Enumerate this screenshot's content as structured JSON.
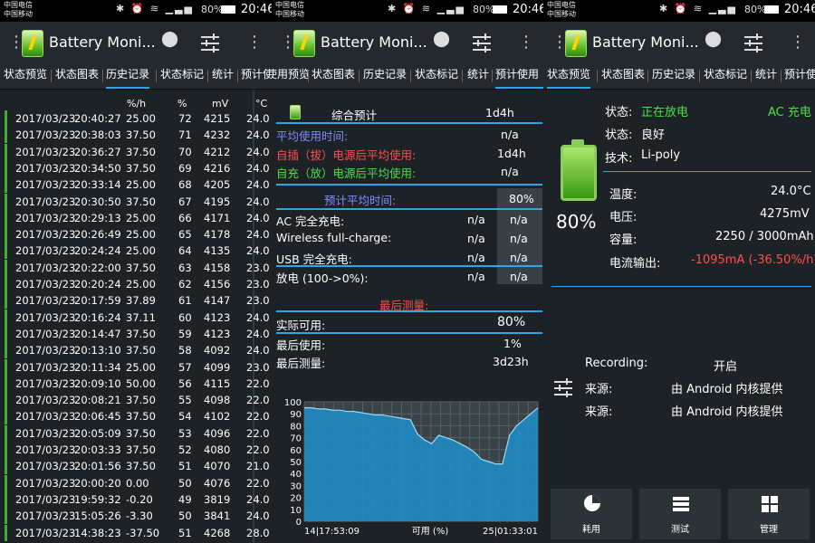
{
  "status": {
    "carrier1": "中国电信",
    "carrier2": "中国移动",
    "battery": "80%",
    "time": "20:46"
  },
  "app": {
    "title": "Battery Moni..."
  },
  "tabs1": [
    "状态预览",
    "状态图表",
    "历史记录",
    "状态标记",
    "统计",
    "预计使"
  ],
  "tabs2": [
    "使用预览",
    "状态图表",
    "历史记录",
    "状态标记",
    "统计",
    "预计使用"
  ],
  "tabs3": [
    "状态预览",
    "状态图表",
    "历史记录",
    "状态标记",
    "统计",
    "预计使"
  ],
  "history": {
    "headers": [
      "%/h",
      "%",
      "mV",
      "°C"
    ],
    "rows": [
      [
        "2017/03/23",
        "20:40:27",
        "25.00",
        "72",
        "4215",
        "24.0"
      ],
      [
        "2017/03/23",
        "20:38:03",
        "37.50",
        "71",
        "4232",
        "24.0"
      ],
      [
        "2017/03/23",
        "20:36:27",
        "37.50",
        "70",
        "4212",
        "24.0"
      ],
      [
        "2017/03/23",
        "20:34:50",
        "37.50",
        "69",
        "4216",
        "24.0"
      ],
      [
        "2017/03/23",
        "20:33:14",
        "25.00",
        "68",
        "4205",
        "24.0"
      ],
      [
        "2017/03/23",
        "20:30:50",
        "37.50",
        "67",
        "4195",
        "24.0"
      ],
      [
        "2017/03/23",
        "20:29:13",
        "25.00",
        "66",
        "4171",
        "24.0"
      ],
      [
        "2017/03/23",
        "20:26:49",
        "25.00",
        "65",
        "4178",
        "24.0"
      ],
      [
        "2017/03/23",
        "20:24:24",
        "25.00",
        "64",
        "4135",
        "24.0"
      ],
      [
        "2017/03/23",
        "20:22:00",
        "37.50",
        "63",
        "4158",
        "23.0"
      ],
      [
        "2017/03/23",
        "20:20:24",
        "25.00",
        "62",
        "4156",
        "23.0"
      ],
      [
        "2017/03/23",
        "20:17:59",
        "37.89",
        "61",
        "4147",
        "23.0"
      ],
      [
        "2017/03/23",
        "20:16:24",
        "37.11",
        "60",
        "4123",
        "24.0"
      ],
      [
        "2017/03/23",
        "20:14:47",
        "37.50",
        "59",
        "4123",
        "24.0"
      ],
      [
        "2017/03/23",
        "20:13:10",
        "37.50",
        "58",
        "4092",
        "24.0"
      ],
      [
        "2017/03/23",
        "20:11:34",
        "25.00",
        "57",
        "4099",
        "23.0"
      ],
      [
        "2017/03/23",
        "20:09:10",
        "50.00",
        "56",
        "4115",
        "22.0"
      ],
      [
        "2017/03/23",
        "20:08:21",
        "37.50",
        "55",
        "4098",
        "22.0"
      ],
      [
        "2017/03/23",
        "20:06:45",
        "37.50",
        "54",
        "4102",
        "22.0"
      ],
      [
        "2017/03/23",
        "20:05:09",
        "37.50",
        "53",
        "4096",
        "22.0"
      ],
      [
        "2017/03/23",
        "20:03:33",
        "37.50",
        "52",
        "4080",
        "22.0"
      ],
      [
        "2017/03/23",
        "20:01:56",
        "37.50",
        "51",
        "4070",
        "21.0"
      ],
      [
        "2017/03/23",
        "20:00:20",
        "0.00",
        "50",
        "4076",
        "22.0"
      ],
      [
        "2017/03/23",
        "19:59:32",
        "-0.20",
        "49",
        "3819",
        "24.0"
      ],
      [
        "2017/03/23",
        "15:05:26",
        "-3.30",
        "50",
        "3841",
        "24.0"
      ],
      [
        "2017/03/23",
        "14:38:23",
        "-37.50",
        "51",
        "4268",
        "28.0"
      ]
    ]
  },
  "estimate": {
    "title": "综合预计",
    "title_val": "1d4h",
    "avg_time": "平均使用时间:",
    "avg_time_val": "n/a",
    "plug": "自插（拔）电源后平均使用:",
    "plug_val": "1d4h",
    "self": "自充（放）电源后平均使用:",
    "self_val": "n/a",
    "est_avg": "预计平均时间:",
    "est_avg_val": "80%",
    "ac": "AC 完全充电:",
    "wireless": "Wireless full-charge:",
    "usb": "USB 完全充电:",
    "discharge": "放电 (100->0%):",
    "na": "n/a",
    "last_title": "最后测量:",
    "actual": "实际可用:",
    "actual_val": "80%",
    "last_use": "最后使用:",
    "last_use_val": "1%",
    "last_measure": "最后测量:",
    "last_measure_val": "3d23h"
  },
  "chart_data": {
    "type": "area",
    "yticks": [
      0,
      10,
      20,
      30,
      40,
      50,
      60,
      70,
      80,
      90,
      100
    ],
    "ylim": [
      0,
      100
    ],
    "xlabel": "可用 (%)",
    "x_start_label": "14|17:53:09",
    "x_end_label": "25|01:33:01",
    "series": [
      {
        "values": [
          95,
          95,
          94,
          94,
          93,
          93,
          92,
          92,
          91,
          90,
          89,
          89,
          88,
          87,
          86,
          85,
          73,
          68,
          65,
          72,
          70,
          68,
          65,
          62,
          58,
          52,
          50,
          48,
          48,
          72,
          80,
          85,
          90,
          95
        ]
      }
    ]
  },
  "overview": {
    "state_lbl": "状态:",
    "state_val": "正在放电",
    "ac_charge": "AC 充电",
    "health_lbl": "状态:",
    "health_val": "良好",
    "tech_lbl": "技术:",
    "tech_val": "Li-poly",
    "percent": "80%",
    "temp_lbl": "温度:",
    "temp_val": "24.0°C",
    "volt_lbl": "电压:",
    "volt_val": "4275mV",
    "cap_lbl": "容量:",
    "cap_val": "2250 / 3000mAh",
    "curr_lbl": "电流输出:",
    "curr_val": "-1095mA (-36.50%/h)",
    "recording_lbl": "Recording:",
    "recording_val": "开启",
    "src_lbl": "来源:",
    "src_val": "由 Android 内核提供",
    "src2_lbl": "来源:",
    "src2_val": "由 Android 内核提供",
    "btn_usage": "耗用",
    "btn_test": "测试",
    "btn_manage": "管理"
  },
  "colors": {
    "accent": "#2fa6e8",
    "green": "#4be04b",
    "red": "#ff4f4f",
    "purple": "#7f8cff",
    "bg": "#1d2226"
  }
}
